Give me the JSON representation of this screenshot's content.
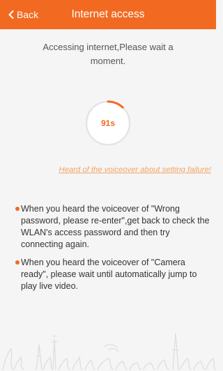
{
  "header": {
    "back_label": "Back",
    "title": "Internet access",
    "color": "#f26a21"
  },
  "status": {
    "message": "Accessing internet,Please wait a moment.",
    "countdown": "91s",
    "progress_fraction": 0.12
  },
  "help_link": "Heard of the voiceover about setting failure!",
  "tips": [
    {
      "text": "When you heard the voiceover of \"Wrong password, please re-enter\",get back to check the WLAN's access password and then try connecting again."
    },
    {
      "text": "When you heard the voiceover of \"Camera ready\", please wait until automatically jump to play live video."
    }
  ],
  "icons": {
    "back": "chevron-left-icon",
    "bullet": "bullet-dot-icon",
    "background": "city-skyline-illustration"
  }
}
